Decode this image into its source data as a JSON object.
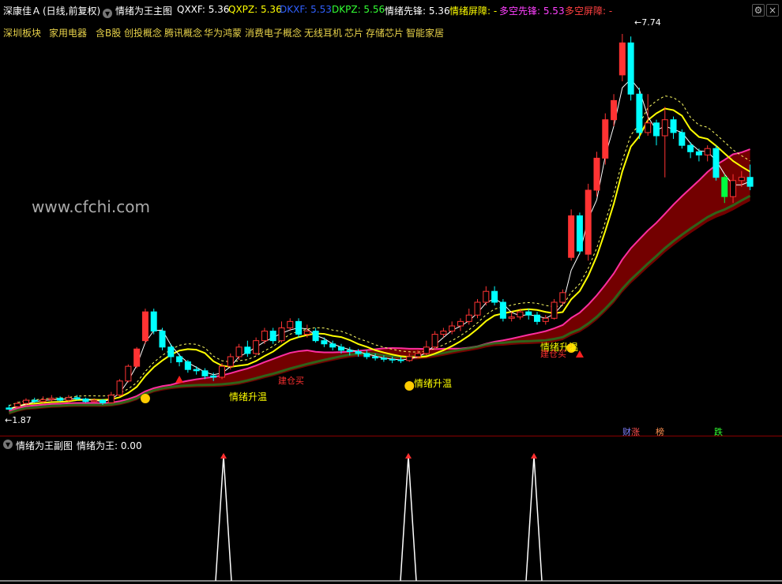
{
  "header": {
    "stock_name": "深康佳Ａ",
    "period": "(日线,前复权)",
    "indicator_title": "情绪为王主图",
    "qxxf": "QXXF: 5.36",
    "qxpz": "QXPZ: 5.36",
    "dkxf": "DKXF: 5.53",
    "dkpz": "DKPZ: 5.56",
    "xianfeng": "情绪先锋: 5.36",
    "pingzhang": "情绪屏障: -",
    "duokong_xianfeng": "多空先锋: 5.53",
    "duokong_pingzhang": "多空屏障: -"
  },
  "tags": [
    "深圳板块",
    "家用电器",
    "含B股",
    "创投概念",
    "腾讯概念",
    "华为鸿蒙",
    "消费电子概念",
    "无线耳机",
    "芯片",
    "存储芯片",
    "智能家居"
  ],
  "main_chart": {
    "max_label": "7.74",
    "min_label": "1.87",
    "watermark": "www.cfchi.com",
    "signal_labels": [
      "情绪升温",
      "情绪升温",
      "情绪升温"
    ],
    "buy_labels": [
      "建仓买",
      "建仓买"
    ],
    "t_marker": "T",
    "badges": [
      "财",
      "涨",
      "榜",
      "跌"
    ]
  },
  "sub_chart": {
    "title": "情绪为王副图",
    "value": "情绪为王: 0.00"
  },
  "colors": {
    "up": "#ff3333",
    "down": "#00ffff",
    "white_line": "#ffffff",
    "yellow_line": "#ffff00",
    "band_dark": "#800000",
    "band_top": "#ff2ea0",
    "signal": "#ffcc00"
  },
  "icons": [
    "chevron-down-icon",
    "gear-icon",
    "close-icon",
    "arrow-left-icon"
  ],
  "chart_data": {
    "type": "candlestick",
    "candles": [
      [
        1.9,
        1.88,
        1.95,
        1.87
      ],
      [
        1.92,
        1.97,
        2.0,
        1.9
      ],
      [
        1.97,
        2.02,
        2.05,
        1.95
      ],
      [
        2.02,
        2.0,
        2.06,
        1.98
      ],
      [
        2.0,
        2.03,
        2.08,
        1.98
      ],
      [
        2.03,
        2.05,
        2.1,
        2.0
      ],
      [
        2.05,
        2.02,
        2.08,
        2.0
      ],
      [
        2.02,
        2.06,
        2.1,
        2.0
      ],
      [
        2.06,
        2.04,
        2.1,
        2.02
      ],
      [
        2.04,
        2.0,
        2.06,
        1.98
      ],
      [
        2.0,
        2.02,
        2.05,
        1.98
      ],
      [
        2.02,
        1.98,
        2.04,
        1.95
      ],
      [
        1.98,
        2.1,
        2.15,
        1.97
      ],
      [
        2.1,
        2.32,
        2.35,
        2.08
      ],
      [
        2.32,
        2.55,
        2.58,
        2.3
      ],
      [
        2.55,
        2.82,
        2.85,
        2.52
      ],
      [
        2.95,
        3.4,
        3.45,
        2.9
      ],
      [
        3.4,
        3.1,
        3.45,
        3.05
      ],
      [
        3.1,
        2.85,
        3.15,
        2.8
      ],
      [
        2.85,
        2.7,
        2.9,
        2.6
      ],
      [
        2.7,
        2.62,
        2.75,
        2.55
      ],
      [
        2.62,
        2.5,
        2.65,
        2.45
      ],
      [
        2.5,
        2.48,
        2.55,
        2.42
      ],
      [
        2.48,
        2.4,
        2.52,
        2.35
      ],
      [
        2.4,
        2.38,
        2.45,
        2.32
      ],
      [
        2.38,
        2.55,
        2.6,
        2.35
      ],
      [
        2.55,
        2.7,
        2.75,
        2.5
      ],
      [
        2.7,
        2.85,
        2.9,
        2.65
      ],
      [
        2.85,
        2.75,
        2.95,
        2.7
      ],
      [
        2.75,
        2.95,
        3.0,
        2.72
      ],
      [
        2.95,
        3.1,
        3.15,
        2.9
      ],
      [
        3.1,
        2.95,
        3.15,
        2.9
      ],
      [
        2.95,
        3.15,
        3.25,
        2.92
      ],
      [
        3.15,
        3.25,
        3.3,
        3.1
      ],
      [
        3.25,
        3.05,
        3.3,
        3.0
      ],
      [
        3.05,
        3.1,
        3.2,
        3.0
      ],
      [
        3.1,
        2.95,
        3.15,
        2.92
      ],
      [
        2.95,
        2.9,
        3.0,
        2.85
      ],
      [
        2.9,
        2.85,
        2.95,
        2.8
      ],
      [
        2.85,
        2.8,
        2.9,
        2.75
      ],
      [
        2.8,
        2.78,
        2.85,
        2.72
      ],
      [
        2.78,
        2.75,
        2.82,
        2.7
      ],
      [
        2.75,
        2.7,
        2.8,
        2.66
      ],
      [
        2.7,
        2.68,
        2.75,
        2.64
      ],
      [
        2.68,
        2.66,
        2.72,
        2.62
      ],
      [
        2.66,
        2.65,
        2.7,
        2.6
      ],
      [
        2.65,
        2.64,
        2.7,
        2.6
      ],
      [
        2.64,
        2.7,
        2.75,
        2.62
      ],
      [
        2.7,
        2.75,
        2.8,
        2.68
      ],
      [
        2.75,
        2.85,
        2.95,
        2.72
      ],
      [
        2.85,
        3.05,
        3.1,
        2.82
      ],
      [
        3.05,
        3.1,
        3.15,
        3.0
      ],
      [
        3.1,
        3.18,
        3.25,
        3.05
      ],
      [
        3.18,
        3.25,
        3.3,
        3.1
      ],
      [
        3.25,
        3.35,
        3.45,
        3.2
      ],
      [
        3.35,
        3.55,
        3.6,
        3.3
      ],
      [
        3.55,
        3.72,
        3.8,
        3.5
      ],
      [
        3.72,
        3.55,
        3.8,
        3.5
      ],
      [
        3.55,
        3.3,
        3.6,
        3.25
      ],
      [
        3.3,
        3.32,
        3.4,
        3.25
      ],
      [
        3.32,
        3.4,
        3.45,
        3.28
      ],
      [
        3.4,
        3.35,
        3.45,
        3.28
      ],
      [
        3.35,
        3.25,
        3.4,
        3.2
      ],
      [
        3.25,
        3.3,
        3.35,
        3.2
      ],
      [
        3.3,
        3.55,
        3.6,
        3.28
      ],
      [
        3.55,
        3.7,
        3.75,
        3.5
      ],
      [
        4.25,
        4.9,
        5.0,
        4.2
      ],
      [
        4.9,
        4.35,
        4.95,
        4.3
      ],
      [
        4.3,
        5.3,
        5.4,
        4.2
      ],
      [
        5.3,
        5.8,
        5.9,
        5.2
      ],
      [
        5.8,
        6.4,
        6.5,
        5.7
      ],
      [
        6.4,
        6.7,
        6.8,
        6.3
      ],
      [
        7.1,
        7.6,
        7.74,
        7.0
      ],
      [
        7.6,
        6.8,
        7.7,
        6.7
      ],
      [
        6.8,
        6.2,
        6.9,
        6.1
      ],
      [
        6.2,
        6.35,
        6.8,
        6.15
      ],
      [
        6.35,
        6.15,
        6.4,
        6.0
      ],
      [
        6.15,
        6.4,
        6.6,
        5.5
      ],
      [
        6.4,
        6.2,
        6.45,
        6.1
      ],
      [
        6.2,
        6.0,
        6.25,
        5.95
      ],
      [
        6.0,
        5.9,
        6.05,
        5.8
      ],
      [
        5.9,
        5.85,
        5.95,
        5.75
      ],
      [
        5.85,
        5.95,
        6.0,
        5.75
      ],
      [
        5.95,
        5.5,
        6.0,
        5.45
      ],
      [
        5.5,
        5.2,
        5.55,
        5.1
      ],
      [
        5.2,
        5.45,
        5.55,
        5.1
      ],
      [
        5.45,
        5.5,
        5.6,
        5.35
      ],
      [
        5.5,
        5.36,
        5.7,
        5.3
      ]
    ],
    "ylim": [
      1.8,
      7.9
    ]
  }
}
